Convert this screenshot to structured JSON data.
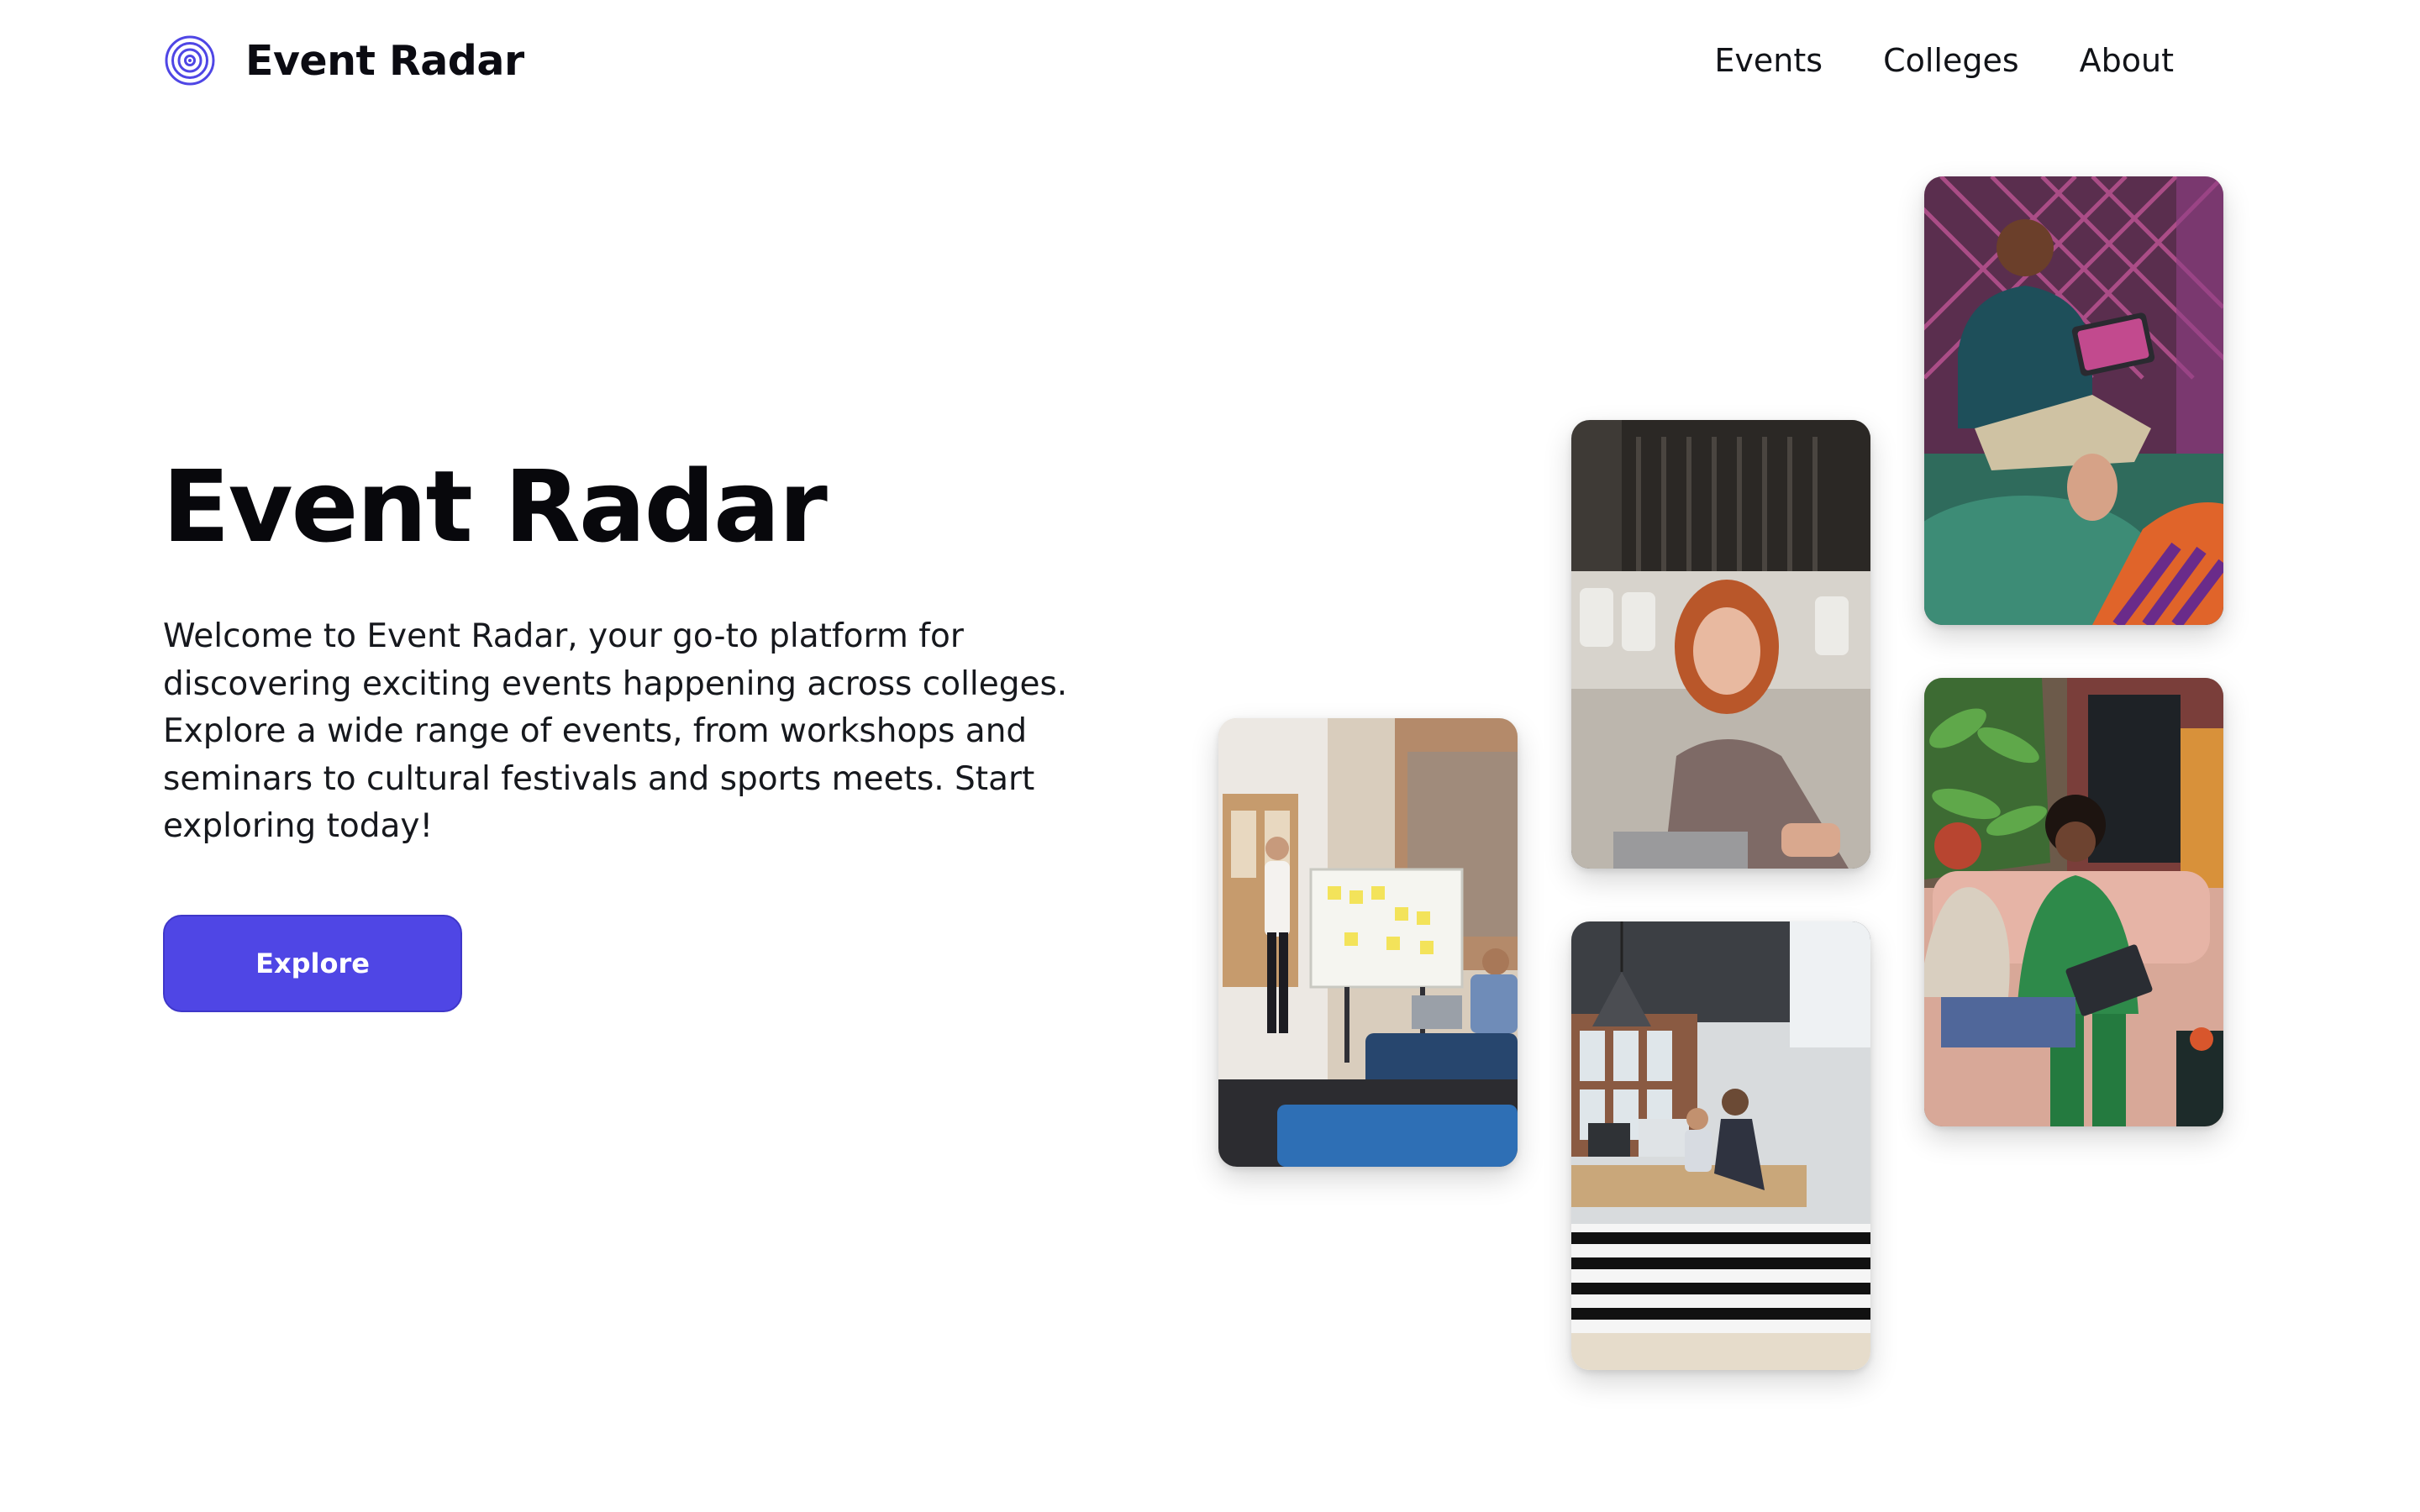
{
  "header": {
    "brand_name": "Event Radar",
    "logo_icon": "radar-rings-icon",
    "nav": [
      {
        "label": "Events"
      },
      {
        "label": "Colleges"
      },
      {
        "label": "About"
      }
    ]
  },
  "hero": {
    "title": "Event Radar",
    "description": "Welcome to Event Radar, your go-to platform for discovering exciting events happening across colleges. Explore a wide range of events, from workshops and seminars to cultural festivals and sports meets. Start exploring today!",
    "cta_label": "Explore"
  },
  "colors": {
    "accent": "#4f46e5",
    "text": "#0b0b12",
    "background": "#ffffff"
  }
}
